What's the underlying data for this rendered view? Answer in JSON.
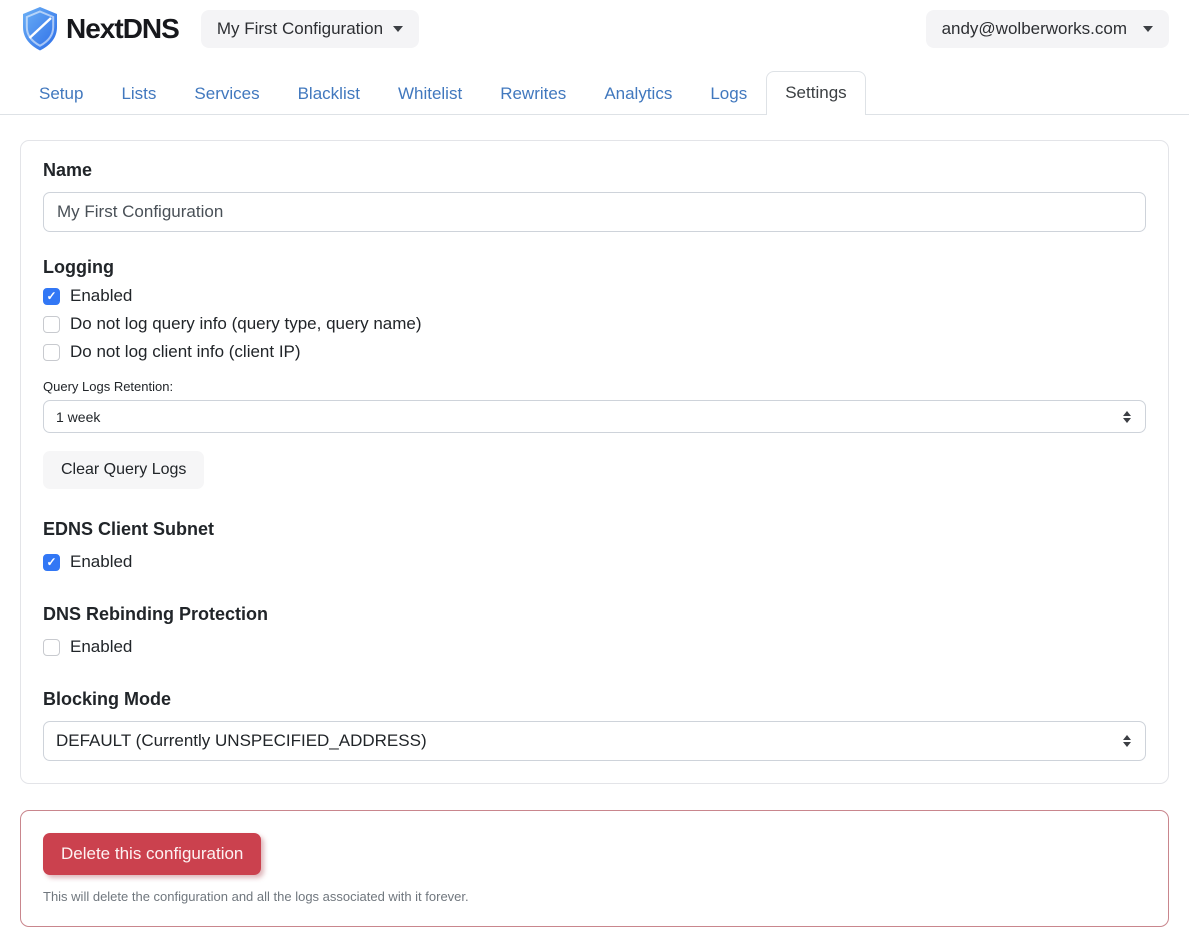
{
  "header": {
    "brand": "NextDNS",
    "config_selector": {
      "label": "My First Configuration"
    },
    "account_selector": {
      "label": "andy@wolberworks.com"
    }
  },
  "tabs": {
    "active": "Settings",
    "items": [
      {
        "label": "Setup"
      },
      {
        "label": "Lists"
      },
      {
        "label": "Services"
      },
      {
        "label": "Blacklist"
      },
      {
        "label": "Whitelist"
      },
      {
        "label": "Rewrites"
      },
      {
        "label": "Analytics"
      },
      {
        "label": "Logs"
      },
      {
        "label": "Settings"
      }
    ]
  },
  "settings": {
    "name": {
      "heading": "Name",
      "value": "My First Configuration"
    },
    "logging": {
      "heading": "Logging",
      "options": [
        {
          "label": "Enabled",
          "checked": true
        },
        {
          "label": "Do not log query info (query type, query name)",
          "checked": false
        },
        {
          "label": "Do not log client info (client IP)",
          "checked": false
        }
      ],
      "retention_label": "Query Logs Retention:",
      "retention_value": "1 week",
      "clear_button_label": "Clear Query Logs"
    },
    "edns": {
      "heading": "EDNS Client Subnet",
      "option": {
        "label": "Enabled",
        "checked": true
      }
    },
    "rebinding": {
      "heading": "DNS Rebinding Protection",
      "option": {
        "label": "Enabled",
        "checked": false
      }
    },
    "blocking": {
      "heading": "Blocking Mode",
      "value": "DEFAULT (Currently UNSPECIFIED_ADDRESS)"
    }
  },
  "danger": {
    "delete_button_label": "Delete this configuration",
    "note": "This will delete the configuration and all the logs associated with it forever."
  },
  "colors": {
    "tab_link": "#4178be",
    "checkbox_checked": "#3277f5",
    "danger_button": "#cb414e",
    "danger_border": "#c9868d",
    "logo_blue_light": "#6cb0f5",
    "logo_blue_dark": "#2c6de8"
  }
}
